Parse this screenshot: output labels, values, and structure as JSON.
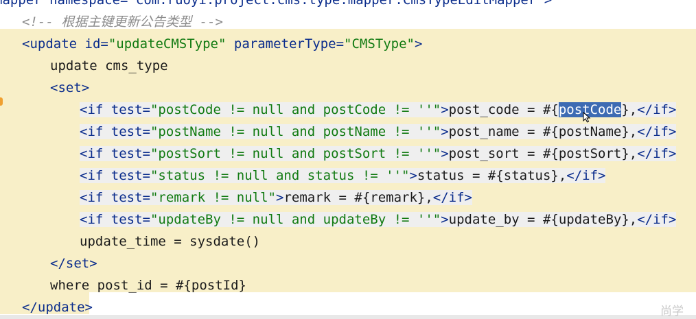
{
  "lines": [
    [
      {
        "t": "mapper namespace=\"com.ruoyi.project.cms.type.mapper.CmsTypeEditMapper\">",
        "c": "tag"
      }
    ],
    [
      {
        "t": "<!-- 根据主键更新公告类型 -->",
        "c": "cmt"
      }
    ],
    [
      {
        "t": "<update ",
        "c": "tag"
      },
      {
        "t": "id=",
        "c": "attr"
      },
      {
        "t": "\"updateCMSType\"",
        "c": "str"
      },
      {
        "t": " parameterType=",
        "c": "attr"
      },
      {
        "t": "\"CMSType\"",
        "c": "str"
      },
      {
        "t": ">",
        "c": "tag"
      }
    ],
    [
      {
        "t": "update cms_type",
        "c": "txt"
      }
    ],
    [
      {
        "t": "<set>",
        "c": "tag"
      }
    ],
    [
      {
        "t": "<if ",
        "c": "tag"
      },
      {
        "t": "test=",
        "c": "attr"
      },
      {
        "t": "\"postCode != null and postCode != ''\"",
        "c": "str"
      },
      {
        "t": ">",
        "c": "tag"
      },
      {
        "t": "post_code = #{",
        "c": "txt"
      },
      {
        "t": "postCode",
        "c": "sel"
      },
      {
        "t": "},",
        "c": "txt"
      },
      {
        "t": "</if>",
        "c": "tag"
      }
    ],
    [
      {
        "t": "<if ",
        "c": "tag"
      },
      {
        "t": "test=",
        "c": "attr"
      },
      {
        "t": "\"postName != null and postName != ''\"",
        "c": "str"
      },
      {
        "t": ">",
        "c": "tag"
      },
      {
        "t": "post_name = #{postName},",
        "c": "txt"
      },
      {
        "t": "</if>",
        "c": "tag"
      }
    ],
    [
      {
        "t": "<if ",
        "c": "tag"
      },
      {
        "t": "test=",
        "c": "attr"
      },
      {
        "t": "\"postSort != null and postSort != ''\"",
        "c": "str"
      },
      {
        "t": ">",
        "c": "tag"
      },
      {
        "t": "post_sort = #{postSort},",
        "c": "txt"
      },
      {
        "t": "</if>",
        "c": "tag"
      }
    ],
    [
      {
        "t": "<if ",
        "c": "tag"
      },
      {
        "t": "test=",
        "c": "attr"
      },
      {
        "t": "\"status != null and status != ''\"",
        "c": "str"
      },
      {
        "t": ">",
        "c": "tag"
      },
      {
        "t": "status = #{status},",
        "c": "txt"
      },
      {
        "t": "</if>",
        "c": "tag"
      }
    ],
    [
      {
        "t": "<if ",
        "c": "tag"
      },
      {
        "t": "test=",
        "c": "attr"
      },
      {
        "t": "\"remark != null\"",
        "c": "str"
      },
      {
        "t": ">",
        "c": "tag"
      },
      {
        "t": "remark = #{remark},",
        "c": "txt"
      },
      {
        "t": "</if>",
        "c": "tag"
      }
    ],
    [
      {
        "t": "<if ",
        "c": "tag"
      },
      {
        "t": "test=",
        "c": "attr"
      },
      {
        "t": "\"updateBy != null and updateBy != ''\"",
        "c": "str"
      },
      {
        "t": ">",
        "c": "tag"
      },
      {
        "t": "update_by = #{updateBy},",
        "c": "txt"
      },
      {
        "t": "</if>",
        "c": "tag"
      }
    ],
    [
      {
        "t": "update_time = sysdate()",
        "c": "txt"
      }
    ],
    [
      {
        "t": "</set>",
        "c": "tag"
      }
    ],
    [
      {
        "t": "where post_id = #{postId}",
        "c": "txt"
      }
    ],
    [
      {
        "t": "</update>",
        "c": "tag"
      }
    ]
  ],
  "watermark": "尚学",
  "colors": {
    "tag": "#0b2d8c",
    "string": "#117a11",
    "comment": "#8c8c8c",
    "selection": "#3d6bb3",
    "band": "#f8efc8"
  }
}
